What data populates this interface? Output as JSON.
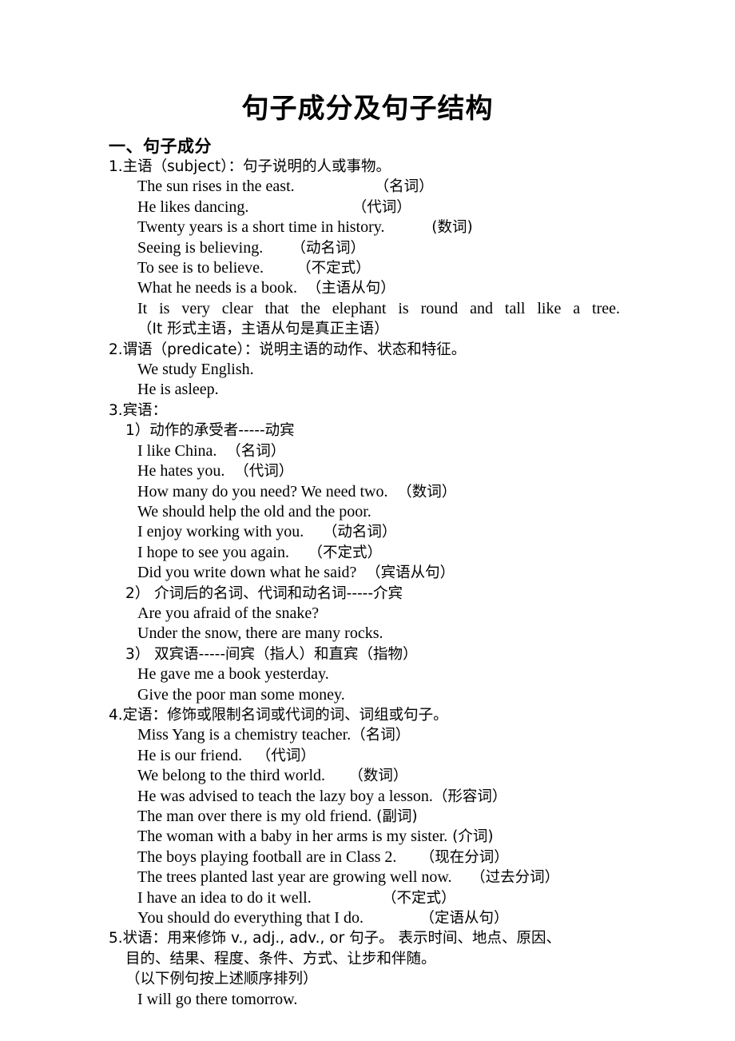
{
  "document": {
    "title": "句子成分及句子结构",
    "section_heading": "一、句子成分"
  },
  "items": {
    "i1": {
      "head": "1.主语（subject）：句子说明的人或事物。",
      "ex1": "The sun rises in the east.",
      "ex1_ann": "（名词）",
      "ex2": "He likes dancing.",
      "ex2_ann": "（代词）",
      "ex3": "Twenty years is a short time in history.",
      "ex3_ann": "(数词)",
      "ex4": "Seeing is believing.",
      "ex4_ann": "（动名词）",
      "ex5": "To see is to believe.",
      "ex5_ann": "（不定式）",
      "ex6": "What he needs is a book.",
      "ex6_ann": "（主语从句）",
      "ex7": "It is very clear that the elephant is round and tall like a tree.",
      "ex7_note": "（It 形式主语，主语从句是真正主语）"
    },
    "i2": {
      "head": "2.谓语（predicate）：说明主语的动作、状态和特征。",
      "ex1": "We study English.",
      "ex2": "He is asleep."
    },
    "i3": {
      "head": "3.宾语：",
      "sub1": "1）动作的承受者-----动宾",
      "s1_ex1": "I like China.",
      "s1_ex1_ann": "（名词）",
      "s1_ex2": "He hates you.",
      "s1_ex2_ann": "（代词）",
      "s1_ex3": "How many do you need? We need two.",
      "s1_ex3_ann": "（数词）",
      "s1_ex4": "We should help the old and the poor.",
      "s1_ex5": "I enjoy working with you.",
      "s1_ex5_ann": "（动名词）",
      "s1_ex6": "I hope to see you again.",
      "s1_ex6_ann": "（不定式）",
      "s1_ex7": "Did you write down what he said?",
      "s1_ex7_ann": "（宾语从句）",
      "sub2": "2） 介词后的名词、代词和动名词-----介宾",
      "s2_ex1": "Are you afraid of the snake?",
      "s2_ex2": "Under the snow, there are many rocks.",
      "sub3": "3） 双宾语-----间宾（指人）和直宾（指物）",
      "s3_ex1": "He gave me a book yesterday.",
      "s3_ex2": "Give the poor man some money."
    },
    "i4": {
      "head": "4.定语：修饰或限制名词或代词的词、词组或句子。",
      "ex1": "Miss Yang is a chemistry teacher.",
      "ex1_ann": "（名词）",
      "ex2": "He is our friend.",
      "ex2_ann": "（代词）",
      "ex3": "We belong to the third world.",
      "ex3_ann": "（数词）",
      "ex4": "He was advised to teach the lazy boy a lesson.",
      "ex4_ann": "（形容词）",
      "ex5": "The man over there is my old friend.",
      "ex5_ann": "(副词)",
      "ex6": "The woman with a baby in her arms is my sister.",
      "ex6_ann": "(介词)",
      "ex7": "The boys playing football are in Class 2.",
      "ex7_ann": "（现在分词）",
      "ex8": "The trees planted last year are growing well now.",
      "ex8_ann": "（过去分词）",
      "ex9": "I have an idea to do it well.",
      "ex9_ann": "（不定式）",
      "ex10": "You should do everything that I do.",
      "ex10_ann": "（定语从句）"
    },
    "i5": {
      "head_l1": "5.状语：用来修饰 v., adj., adv., or 句子。 表示时间、地点、原因、",
      "head_l2": "目的、结果、程度、条件、方式、让步和伴随。",
      "note": "（以下例句按上述顺序排列）",
      "ex1": "I will go there tomorrow."
    }
  }
}
